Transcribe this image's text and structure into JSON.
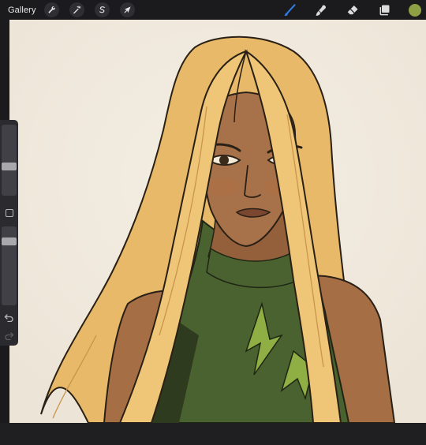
{
  "topbar": {
    "gallery_label": "Gallery",
    "left_tools": [
      {
        "name": "actions",
        "icon": "wrench-icon"
      },
      {
        "name": "adjustments",
        "icon": "magic-wand-icon"
      },
      {
        "name": "selection",
        "icon": "selection-s-icon"
      },
      {
        "name": "transform",
        "icon": "arrow-cursor-icon"
      }
    ],
    "right_tools": [
      {
        "name": "brush",
        "icon": "brush-icon",
        "active": true
      },
      {
        "name": "smudge",
        "icon": "smudge-icon"
      },
      {
        "name": "eraser",
        "icon": "eraser-icon"
      },
      {
        "name": "layers",
        "icon": "layers-icon"
      }
    ],
    "current_color": "#8ea043"
  },
  "sidebar": {
    "brush_size": 0.4,
    "opacity": 0.15,
    "modify_button": "square-icon",
    "undo": "undo-icon",
    "redo": "redo-icon"
  },
  "colors": {
    "accent": "#2f7fe8",
    "canvas": "#f1ebe0",
    "hair": "#ecc073",
    "skin": "#a77249",
    "suit": "#4a6130",
    "suit_light": "#8fae43"
  }
}
